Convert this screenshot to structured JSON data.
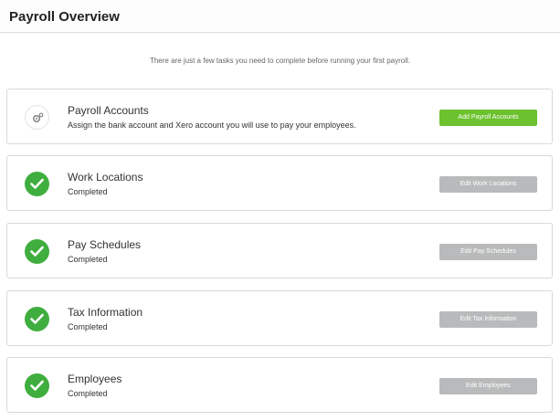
{
  "header": {
    "title": "Payroll Overview"
  },
  "intro": "There are just a few tasks you need to complete before running your first payroll.",
  "colors": {
    "check_green": "#3fae3f",
    "action_green": "#6cc12f",
    "disabled_gray": "#b9babb"
  },
  "tasks": [
    {
      "title": "Payroll Accounts",
      "subtitle": "Assign the bank account and Xero account you will use to pay your employees.",
      "button": "Add Payroll Accounts",
      "status_icon": "gear-icon"
    },
    {
      "title": "Work Locations",
      "subtitle": "Completed",
      "button": "Edit Work Locations",
      "status_icon": "check-icon"
    },
    {
      "title": "Pay Schedules",
      "subtitle": "Completed",
      "button": "Edit Pay Schedules",
      "status_icon": "check-icon"
    },
    {
      "title": "Tax Information",
      "subtitle": "Completed",
      "button": "Edit Tax Information",
      "status_icon": "check-icon"
    },
    {
      "title": "Employees",
      "subtitle": "Completed",
      "button": "Edit Employees",
      "status_icon": "check-icon"
    }
  ]
}
